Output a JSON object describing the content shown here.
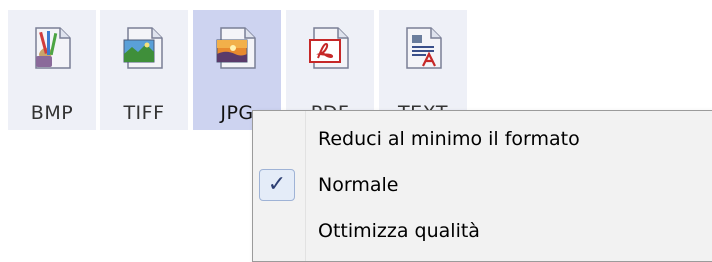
{
  "format_bar": {
    "tiles": [
      {
        "label": "BMP",
        "icon": "bmp-paint-icon"
      },
      {
        "label": "TIFF",
        "icon": "tiff-image-icon"
      },
      {
        "label": "JPG",
        "icon": "jpg-photo-icon"
      },
      {
        "label": "PDF",
        "icon": "pdf-icon"
      },
      {
        "label": "TEXT",
        "icon": "text-document-icon"
      }
    ],
    "selected": "JPG"
  },
  "context_menu": {
    "items": [
      {
        "label": "Reduci al minimo il formato",
        "checked": false
      },
      {
        "label": "Normale",
        "checked": true
      },
      {
        "label": "Ottimizza qualità",
        "checked": false
      }
    ],
    "check_glyph": "✓"
  },
  "colors": {
    "tile_bg": "#eef0f7",
    "tile_selected_bg": "#cdd3f0",
    "menu_bg": "#f2f2f2",
    "check_color": "#2d3f73"
  }
}
